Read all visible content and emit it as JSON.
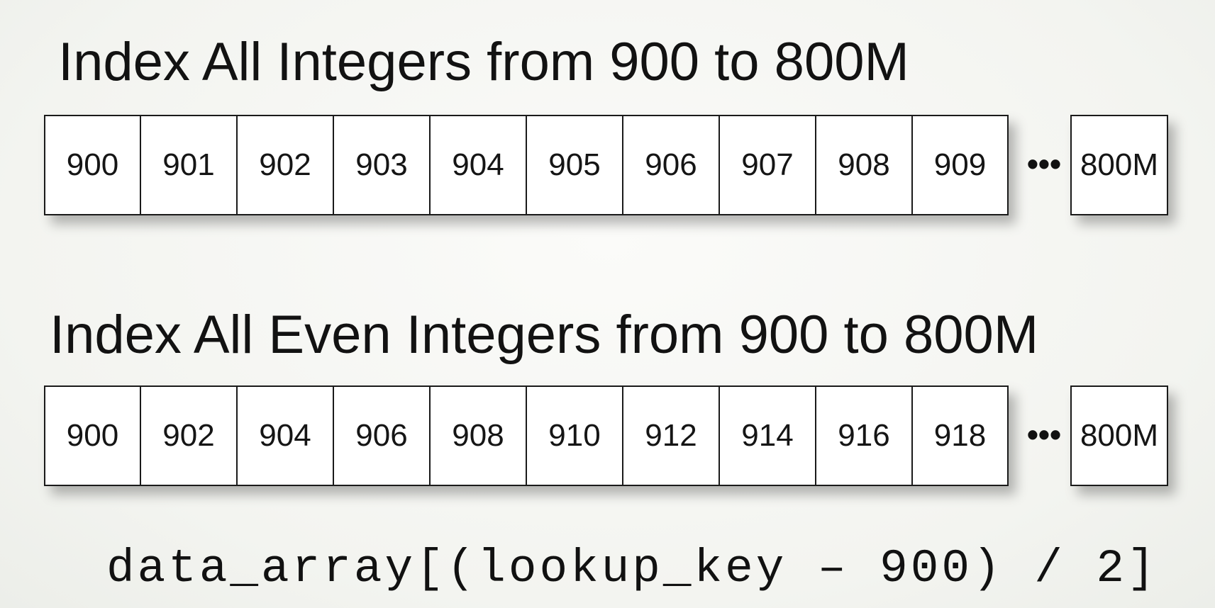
{
  "section1": {
    "title": "Index All Integers from 900 to 800M",
    "cells": [
      "900",
      "901",
      "902",
      "903",
      "904",
      "905",
      "906",
      "907",
      "908",
      "909"
    ],
    "ellipsis": "•••",
    "last_cell": "800M"
  },
  "section2": {
    "title": "Index All Even Integers from 900 to 800M",
    "cells": [
      "900",
      "902",
      "904",
      "906",
      "908",
      "910",
      "912",
      "914",
      "916",
      "918"
    ],
    "ellipsis": "•••",
    "last_cell": "800M"
  },
  "code": "data_array[(lookup_key – 900) / 2]"
}
